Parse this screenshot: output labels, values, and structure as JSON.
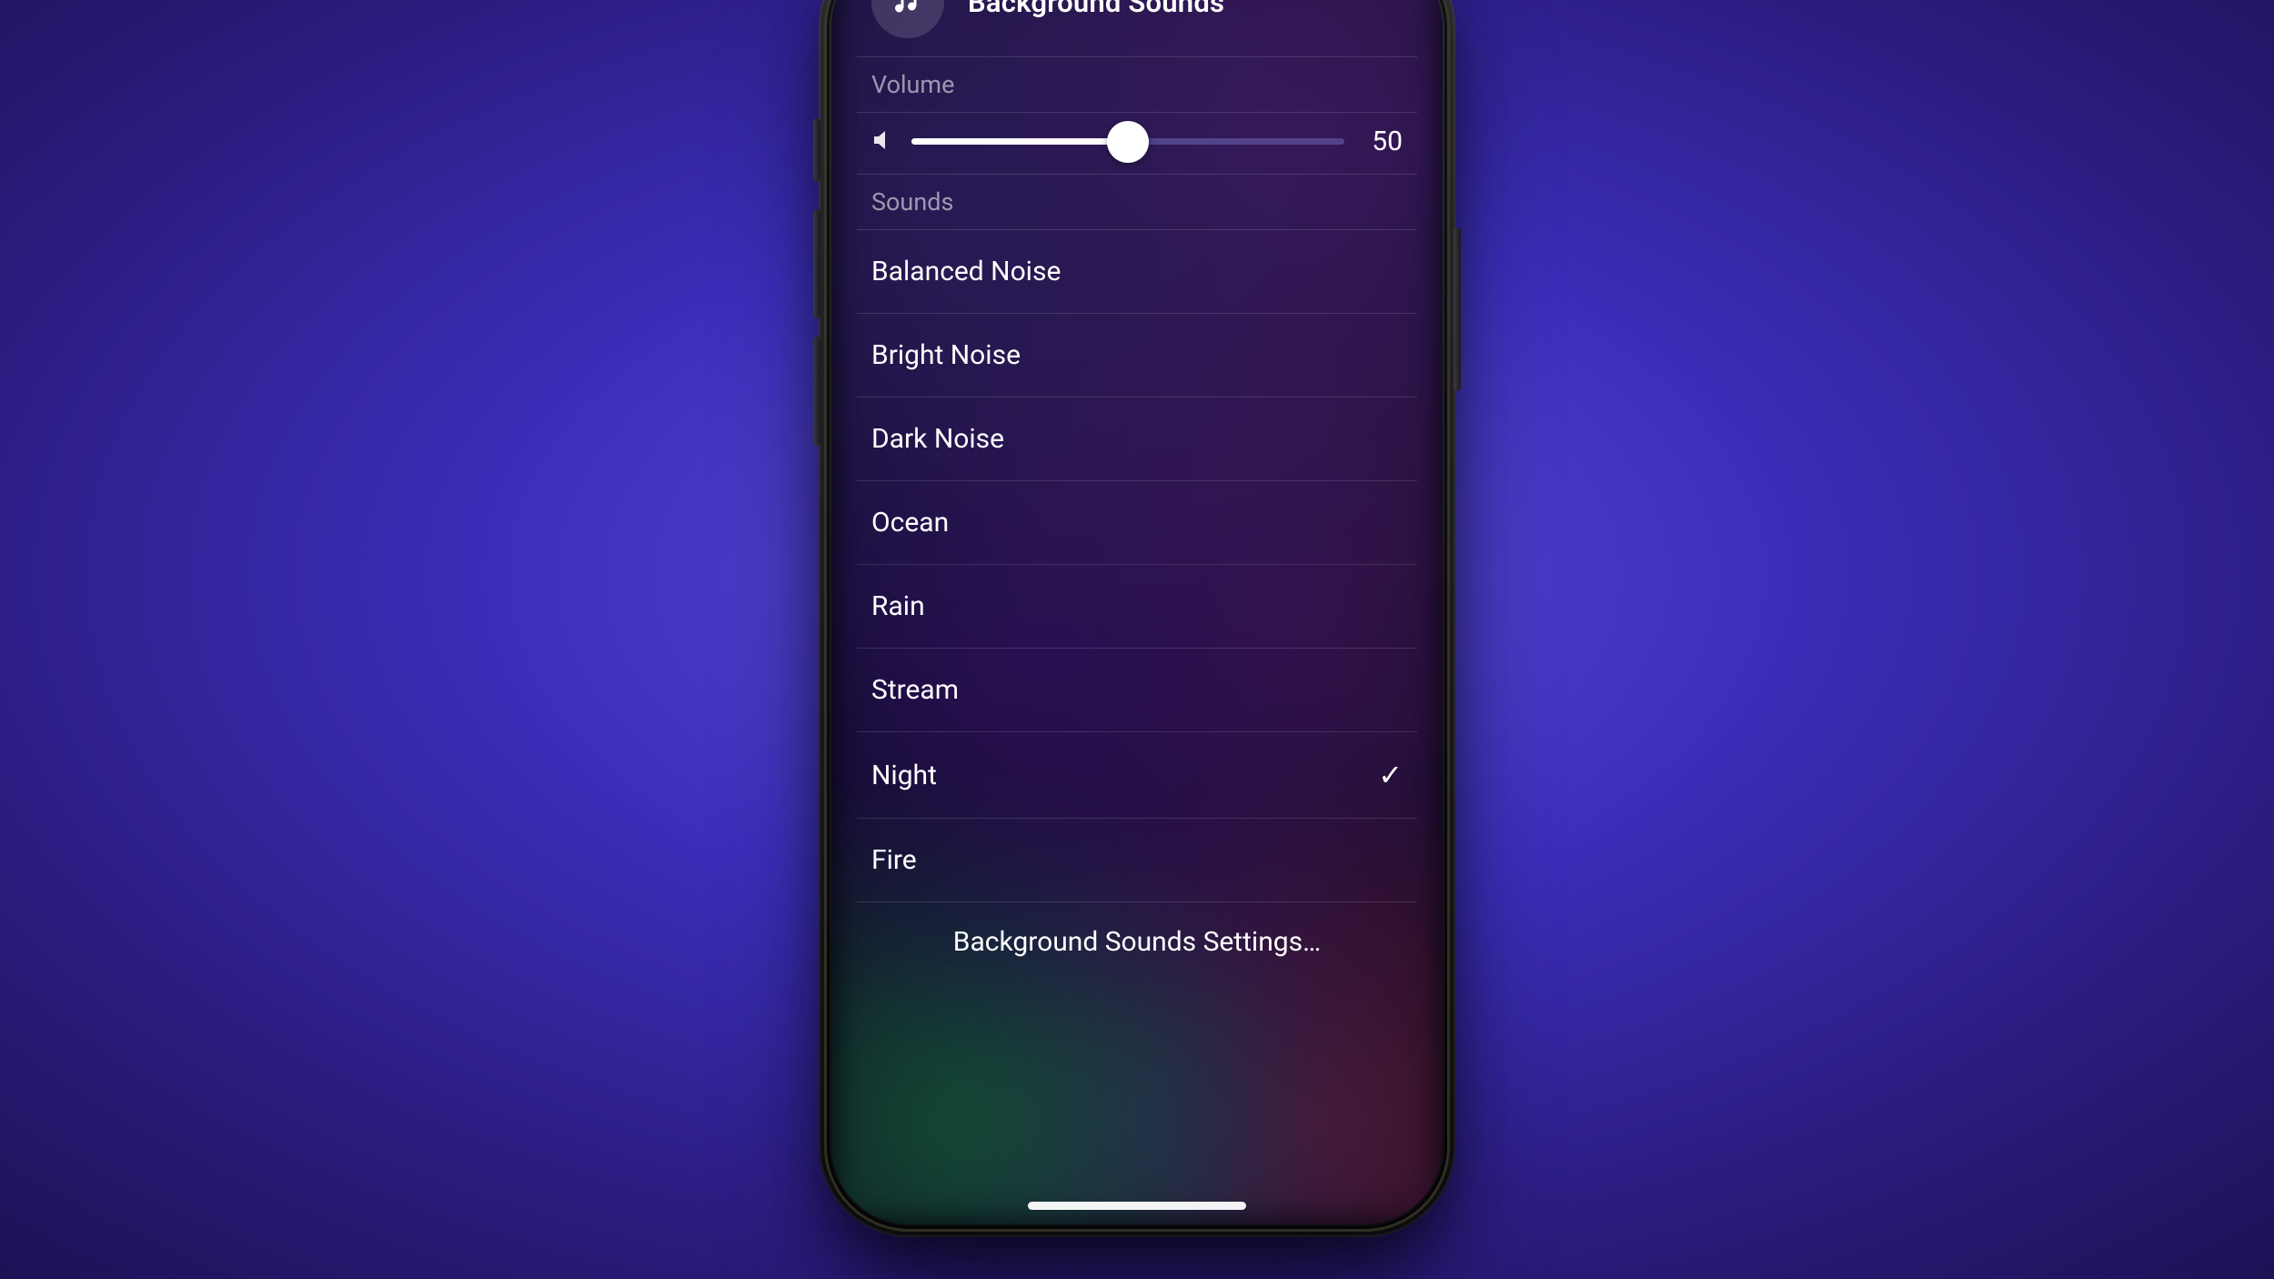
{
  "header": {
    "title": "Background Sounds",
    "icon_name": "hearing-icon"
  },
  "volume": {
    "label": "Volume",
    "value": "50",
    "percent": 50
  },
  "sounds": {
    "label": "Sounds",
    "items": [
      {
        "label": "Balanced Noise",
        "selected": false
      },
      {
        "label": "Bright Noise",
        "selected": false
      },
      {
        "label": "Dark Noise",
        "selected": false
      },
      {
        "label": "Ocean",
        "selected": false
      },
      {
        "label": "Rain",
        "selected": false
      },
      {
        "label": "Stream",
        "selected": false
      },
      {
        "label": "Night",
        "selected": true
      },
      {
        "label": "Fire",
        "selected": false
      }
    ]
  },
  "footer": {
    "settings_label": "Background Sounds Settings…"
  }
}
